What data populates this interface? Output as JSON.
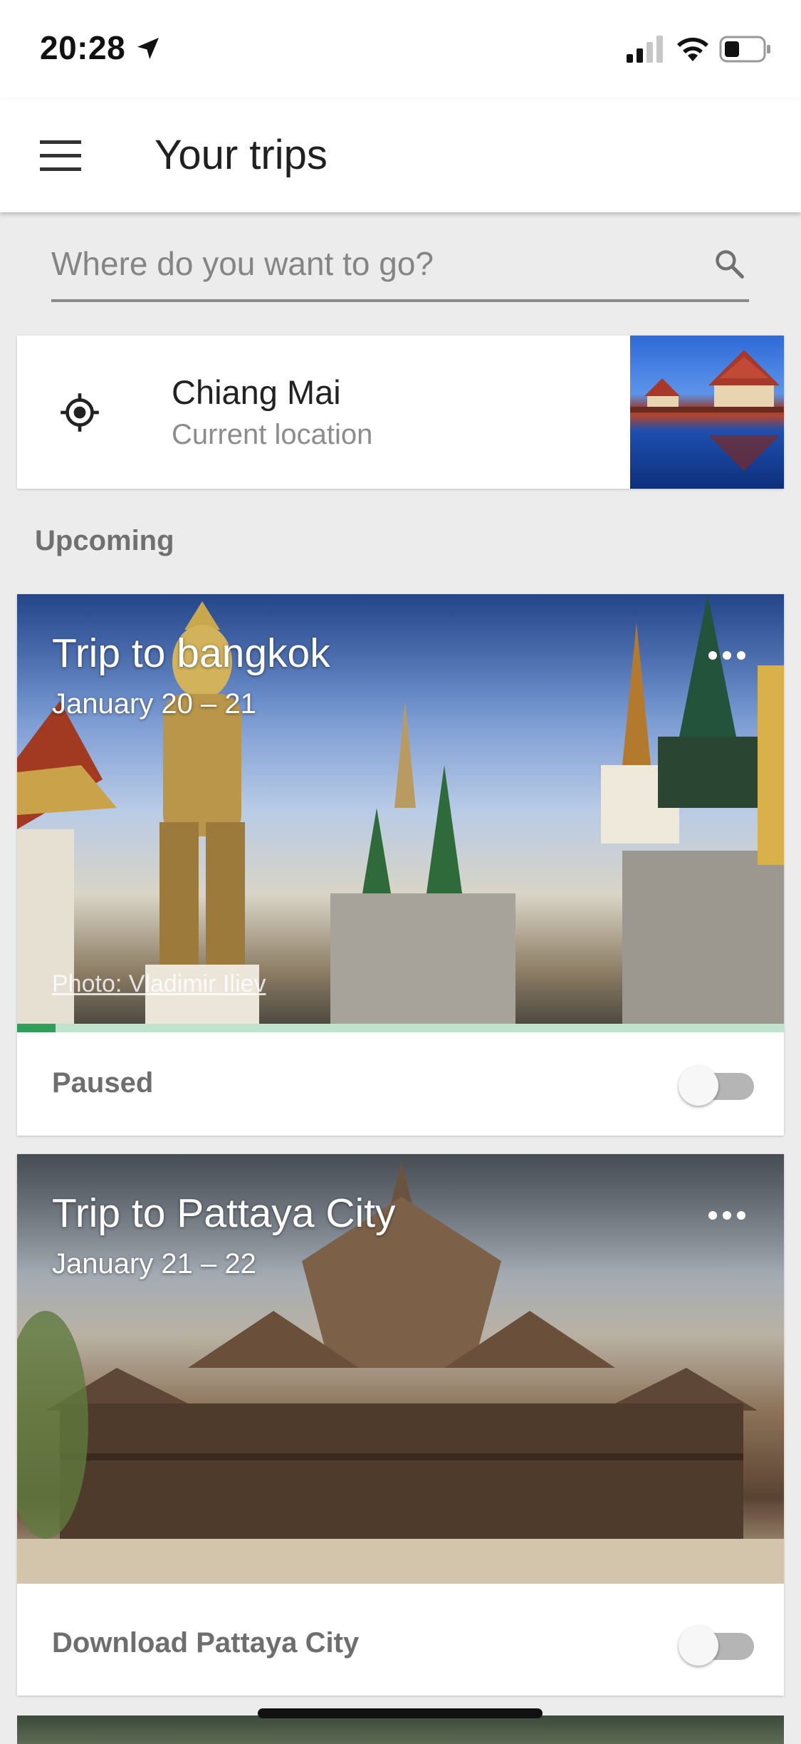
{
  "status_bar": {
    "time": "20:28",
    "icons": [
      "location-arrow-icon",
      "cellular-signal-icon",
      "wifi-icon",
      "battery-icon"
    ]
  },
  "app_bar": {
    "title": "Your trips",
    "menu_icon": "hamburger-menu-icon"
  },
  "search": {
    "placeholder": "Where do you want to go?",
    "value": "",
    "icon": "search-icon"
  },
  "current_location": {
    "name": "Chiang Mai",
    "subtitle": "Current location",
    "icon": "my-location-icon"
  },
  "sections": {
    "upcoming": "Upcoming"
  },
  "trips": [
    {
      "title": "Trip to bangkok",
      "dates": "January 20 – 21",
      "photo_credit": "Photo: Vladimir Iliev",
      "download_progress": 0.05,
      "footer_label": "Paused",
      "toggle_on": false
    },
    {
      "title": "Trip to Pattaya City",
      "dates": "January 21 – 22",
      "footer_label": "Download Pattaya City",
      "toggle_on": false
    }
  ],
  "colors": {
    "progress": "#2e9e58",
    "progress_track": "#bfe3cc",
    "background": "#ececec"
  }
}
